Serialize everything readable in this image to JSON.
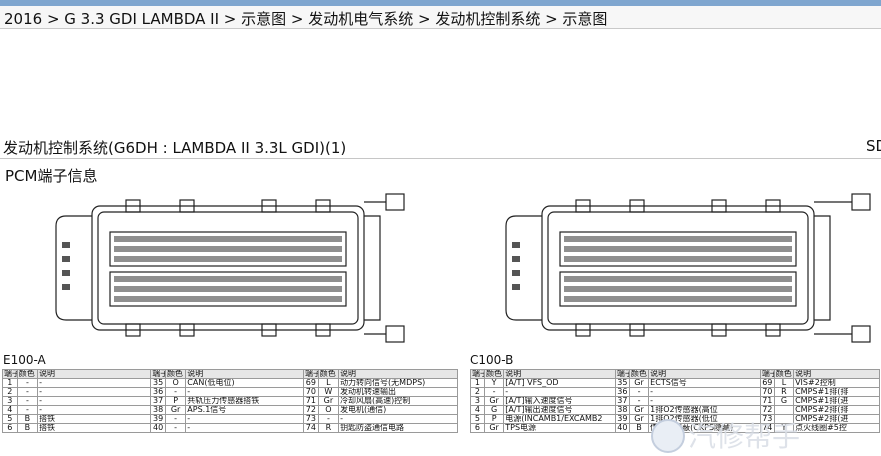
{
  "breadcrumb": "2016 > G 3.3 GDI LAMBDA II > 示意图 > 发动机电气系统 > 发动机控制系统 > 示意图",
  "heading": "发动机控制系统(G6DH : LAMBDA II 3.3L GDI)(1)",
  "heading_right": "SD",
  "section_title": "PCM端子信息",
  "connectors": [
    {
      "label": "E100-A"
    },
    {
      "label": "C100-B"
    }
  ],
  "table_headers": [
    "端子",
    "颜色",
    "说明"
  ],
  "table_a": [
    [
      [
        "1",
        "-",
        "-"
      ],
      [
        "35",
        "O",
        "CAN(低电位)"
      ],
      [
        "69",
        "L",
        "动力转向信号(无MDPS)"
      ]
    ],
    [
      [
        "2",
        "-",
        "-"
      ],
      [
        "36",
        "-",
        "-"
      ],
      [
        "70",
        "W",
        "发动机转速输出"
      ]
    ],
    [
      [
        "3",
        "-",
        "-"
      ],
      [
        "37",
        "P",
        "共轨压力传感器搭铁"
      ],
      [
        "71",
        "Gr",
        "冷却风扇(高速)控制"
      ]
    ],
    [
      [
        "4",
        "-",
        "-"
      ],
      [
        "38",
        "Gr",
        "APS.1信号"
      ],
      [
        "72",
        "O",
        "发电机(通信)"
      ]
    ],
    [
      [
        "5",
        "B",
        "搭铁"
      ],
      [
        "39",
        "-",
        "-"
      ],
      [
        "73",
        "-",
        "-"
      ]
    ],
    [
      [
        "6",
        "B",
        "搭铁"
      ],
      [
        "40",
        "-",
        "-"
      ],
      [
        "74",
        "R",
        "钥匙防盗通信电路"
      ]
    ]
  ],
  "table_b": [
    [
      [
        "1",
        "Y",
        "[A/T] VFS_OD"
      ],
      [
        "35",
        "Gr",
        "ECTS信号"
      ],
      [
        "69",
        "L",
        "VIS#2控制"
      ]
    ],
    [
      [
        "2",
        "-",
        "-"
      ],
      [
        "36",
        "-",
        "-"
      ],
      [
        "70",
        "R",
        "CMPS#1排(排"
      ]
    ],
    [
      [
        "3",
        "Gr",
        "[A/T]输入速度信号"
      ],
      [
        "37",
        "-",
        "-"
      ],
      [
        "71",
        "G",
        "CMPS#1排(进"
      ]
    ],
    [
      [
        "4",
        "G",
        "[A/T]输出速度信号"
      ],
      [
        "38",
        "Gr",
        "1排O2传感器(高位"
      ],
      [
        "72",
        "",
        "CMPS#2排(排"
      ]
    ],
    [
      [
        "5",
        "P",
        "电源(INCAMB1/EXCAMB2"
      ],
      [
        "39",
        "Gr",
        "1排O2传感器(低位"
      ],
      [
        "73",
        "",
        "CMPS#2排(进"
      ]
    ],
    [
      [
        "6",
        "Gr",
        "TPS电源"
      ],
      [
        "40",
        "B",
        "传感器屏蔽(CKPS隐藏)"
      ],
      [
        "74",
        "Y",
        "点火线圈#5控"
      ]
    ]
  ],
  "watermark": "汽修帮手"
}
